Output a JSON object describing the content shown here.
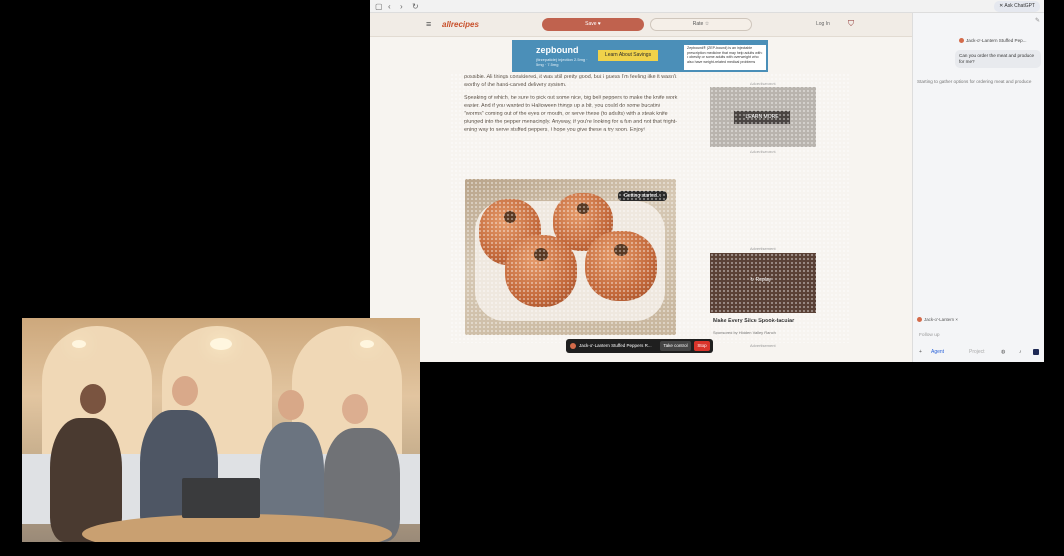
{
  "browser": {
    "ask_chatgpt": "Ask ChatGPT"
  },
  "site": {
    "logo": "allrecipes",
    "save_label": "Save ♥",
    "rate_label": "Rate ☆",
    "login_label": "Log In"
  },
  "ad_banner": {
    "brand": "zepbound",
    "learn_label": "Learn About Savings",
    "sub": "(tirzepatide) injection 2.5mg · 5mg · 7.5mg",
    "text": "Zepbound® (ZEP-bound) is an injectable prescription medicine that may help adults with: • obesity or some adults with overweight who also have weight-related medical problems"
  },
  "article": {
    "p1": "possible. All things considered, it was still pretty good, but I guess I'm feeling like it wasn't worthy of the hand-carved delivery system.",
    "p2": "Speaking of which, be sure to pick out some nice, big bell peppers to make the knife work easier. And if you wanted to Halloween things up a bit, you could do some bucatini \"worms\" coming out of the eyes or mouth, or serve these (to adults) with a steak knife plunged into the pepper menacingly. Anyway, if you're looking for a fun and not that fright-ening way to serve stuffed peppers, I hope you give these a try soon. Enjoy!"
  },
  "image": {
    "overlay": "Getting started..."
  },
  "right_ads": {
    "advertisement": "Advertisement",
    "learn_more": "LEARN MORE",
    "replay": "Replay",
    "card_title": "Make Every Slice Spook-tacular",
    "sponsor": "Sponsored by Hidden Valley Ranch"
  },
  "agent_bar": {
    "title": "Jack-o'-Lantern Stuffed Peppers R...",
    "take_control": "Take control",
    "stop": "Stop"
  },
  "sidebar": {
    "task_title": "Jack-o'-Lantern Stuffed Pep...",
    "user_message": "Can you order the meat and produce for me?",
    "status": "Starting to gather options for ordering meat and produce",
    "chip": "Jack-o'-Lantern",
    "followup_placeholder": "Follow up",
    "agent_label": "Agent",
    "project_label": "Project"
  }
}
